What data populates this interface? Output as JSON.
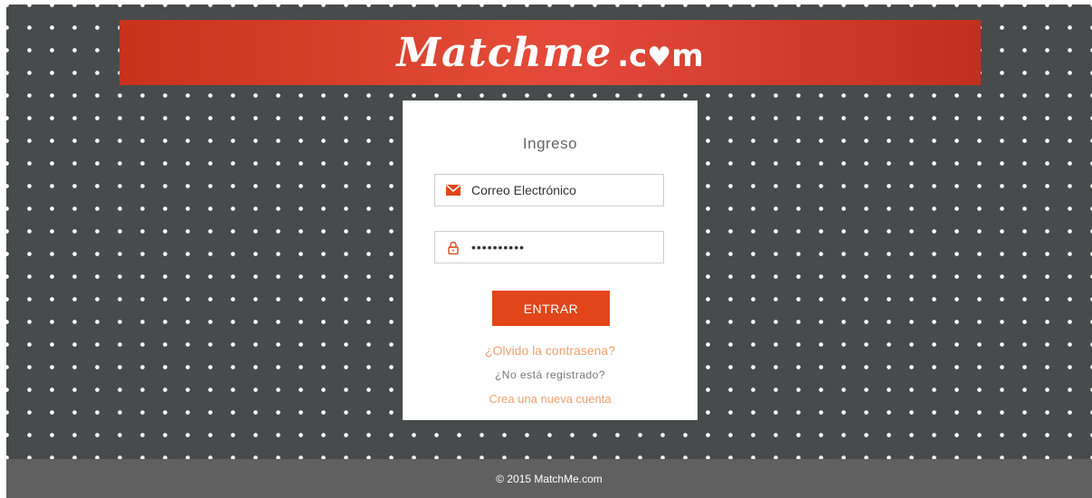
{
  "brand": {
    "logo_script": "Matchme",
    "logo_dot_c": ".c",
    "logo_m": "m",
    "colors": {
      "banner": "#d83a24",
      "accent": "#e1461a",
      "link": "#f0a070",
      "background": "#474b4c",
      "footer": "#606060"
    }
  },
  "login": {
    "title": "Ingreso",
    "email_value": "Correo Electrónico",
    "email_icon": "envelope-icon",
    "password_masked": "••••••••••",
    "password_icon": "lock-icon",
    "submit_label": "ENTRAR",
    "forgot_link": "¿Olvido la contrasena?",
    "not_registered": "¿No está registrado?",
    "create_link": "Crea una nueva cuenta"
  },
  "footer": {
    "copyright": "© 2015 MatchMe.com"
  }
}
